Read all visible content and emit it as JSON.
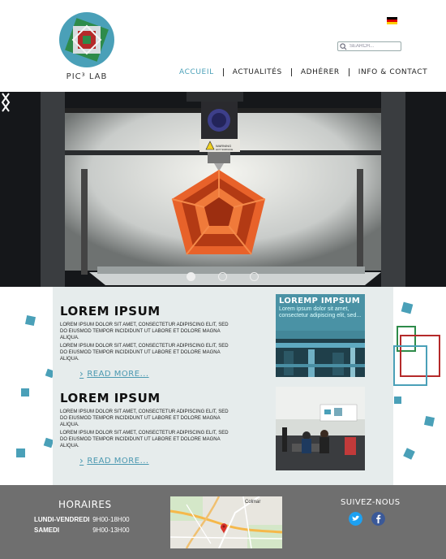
{
  "header": {
    "logo_text": "PIC³ LAB",
    "search_placeholder": "SEARCH...",
    "language_icon": "german-flag-icon"
  },
  "nav": {
    "items": [
      {
        "label": "ACCUEIL",
        "active": true
      },
      {
        "label": "ACTUALITÉS",
        "active": false
      },
      {
        "label": "ADHÉRER",
        "active": false
      },
      {
        "label": "INFO & CONTACT",
        "active": false
      }
    ]
  },
  "hero": {
    "image": "3d-printer-printing-orange-dodecahedron",
    "printer_label": "WARNING HOT SURFACE",
    "slides": 3,
    "active_slide": 1
  },
  "articles": [
    {
      "title": "LOREM IPSUM",
      "body1": "Lorem ipsum dolor sit amet, consectetur adipiscing elit, sed do eiusmod tempor incididunt ut labore et dolore magna aliqua.",
      "body2": "Lorem ipsum dolor sit amet, consectetur adipiscing elit, sed do eiusmod tempor incididunt ut labore et dolore magna aliqua.",
      "read_more": "READ MORE..."
    },
    {
      "title": "LOREM IPSUM",
      "body1": "Lorem ipsum dolor sit amet, consectetur adipiscing elit, sed do eiusmod tempor incididunt ut labore et dolore magna aliqua.",
      "body2": "Lorem ipsum dolor sit amet, consectetur adipiscing elit, sed do eiusmod tempor incididunt ut labore et dolore magna aliqua.",
      "read_more": "READ MORE..."
    }
  ],
  "feature_card": {
    "title": "LOREMP IMPSUM",
    "text": "Lorem ipsum dolor sit amet, consectetur adipiscing elit, sed..."
  },
  "footer": {
    "hours_title": "HORAIRES",
    "hours": [
      {
        "day": "LUNDI-VENDREDI",
        "time": "9H00-18H00"
      },
      {
        "day": "SAMEDI",
        "time": "9H00-13H00"
      }
    ],
    "map_label": "Colmar",
    "follow_title": "SUIVEZ-NOUS",
    "social": [
      "twitter-icon",
      "facebook-icon"
    ]
  },
  "colors": {
    "accent": "#4aa0b8",
    "footer_bg": "#6f6f6f",
    "content_bg": "#e6ecec"
  }
}
